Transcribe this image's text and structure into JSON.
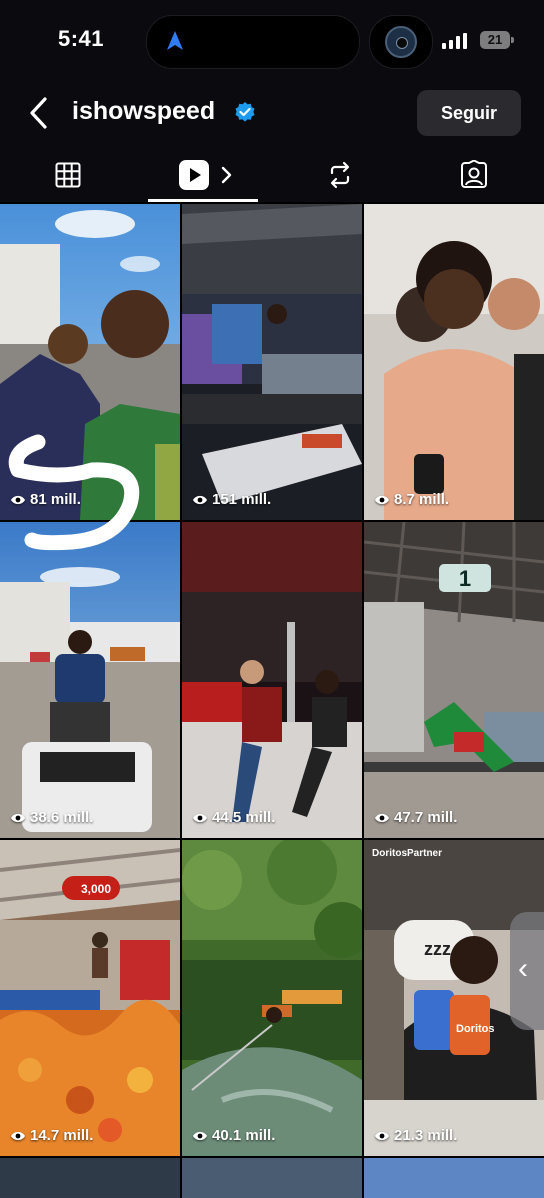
{
  "status": {
    "time": "5:41",
    "battery": "21"
  },
  "header": {
    "username": "ishowspeed",
    "follow_label": "Seguir"
  },
  "tabs": [
    {
      "name": "grid-icon"
    },
    {
      "name": "reels-icon",
      "active": true
    },
    {
      "name": "reposts-icon"
    },
    {
      "name": "tagged-icon"
    }
  ],
  "videos": [
    {
      "views": "81 mill."
    },
    {
      "views": "151 mill."
    },
    {
      "views": "8.7 mill."
    },
    {
      "views": "38.6 mill."
    },
    {
      "views": "44.5 mill."
    },
    {
      "views": "47.7 mill."
    },
    {
      "views": "14.7 mill."
    },
    {
      "views": "40.1 mill."
    },
    {
      "views": "21.3 mill."
    }
  ],
  "overlays": {
    "tile6_counter": "1",
    "tile7_badge": "3,000",
    "tile9_partner": "DoritosPartner",
    "tile9_zzz": "zzz",
    "tile9_brand": "Doritos"
  },
  "colors": {
    "verified": "#1d9bf0",
    "follow_bg": "#2a2a2f"
  }
}
